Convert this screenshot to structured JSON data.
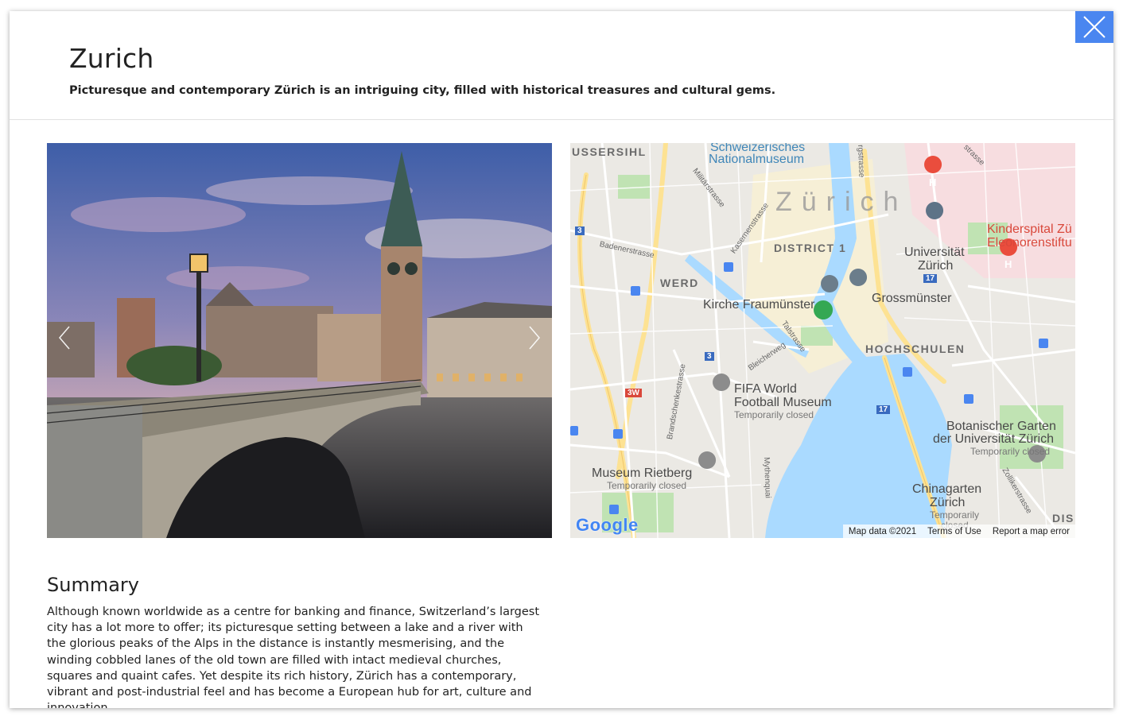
{
  "header": {
    "title": "Zurich",
    "subtitle": "Picturesque and contemporary Zürich is an intriguing city, filled with historical treasures and cultural gems."
  },
  "close_icon": "close-icon",
  "carousel": {
    "prev_icon": "chevron-left-icon",
    "next_icon": "chevron-right-icon"
  },
  "map": {
    "labels": {
      "ussersihl": "USSERSIHL",
      "nationalmuseum_1": "Schweizerisches",
      "nationalmuseum_2": "Nationalmuseum",
      "zurich": "Zürich",
      "district1": "DISTRICT 1",
      "werd": "WERD",
      "fraumuenster": "Kirche Fraumünster",
      "grossmuenster": "Grossmünster",
      "hochschulen": "HOCHSCHULEN",
      "universitaet_1": "Universität",
      "universitaet_2": "Zürich",
      "kinderspital_1": "Kinderspital Zü",
      "kinderspital_2": "Eleonorenstiftu",
      "fifa_1": "FIFA World",
      "fifa_2": "Football Museum",
      "fifa_status": "Temporarily closed",
      "rietberg": "Museum Rietberg",
      "rietberg_status": "Temporarily closed",
      "botanischer_1": "Botanischer Garten",
      "botanischer_2": "der Universität Zürich",
      "botanischer_status": "Temporarily closed",
      "chinagarten_1": "Chinagarten",
      "chinagarten_2": "Zürich",
      "chinagarten_status": "Temporarily",
      "chinagarten_status2": "closed",
      "dis": "DIS",
      "badenerstrasse": "Badenerstrasse",
      "militaerstrasse": "Militärstrasse",
      "kasernenstrasse": "Kasernenstrasse",
      "talstrasse": "Talstrasse",
      "bleicherweg": "Bleicherweg",
      "brandschenkestrasse": "Brandschenkestrasse",
      "mythenquai": "Mythenquai",
      "zollikerstrasse": "Zollikerstrasse",
      "rgstrasse": "rgstrasse",
      "strasse": "strasse",
      "route_3a": "3",
      "route_3b": "3",
      "route_3w": "3W",
      "route_17a": "17",
      "route_17b": "17"
    },
    "google_logo": "Google",
    "footer": {
      "map_data": "Map data ©2021",
      "terms": "Terms of Use",
      "report": "Report a map error"
    }
  },
  "summary": {
    "heading": "Summary",
    "text": "Although known worldwide as a centre for banking and finance, Switzerland’s largest city has a lot more to offer; its picturesque setting between a lake and a river with the glorious peaks of the Alps in the distance is instantly mesmerising, and the winding cobbled lanes of the old town are filled with intact medieval churches, squares and quaint cafes. Yet despite its rich history, Zürich has a contemporary, vibrant and post-industrial feel and has become a European hub for art, culture and innovation."
  },
  "colors": {
    "accent": "#4a86f0",
    "water": "#aadaff",
    "map_bg": "#e8e6e2",
    "road_yellow": "#fde293",
    "park_green": "#c0e3b3",
    "poi_red": "#d9483b"
  }
}
